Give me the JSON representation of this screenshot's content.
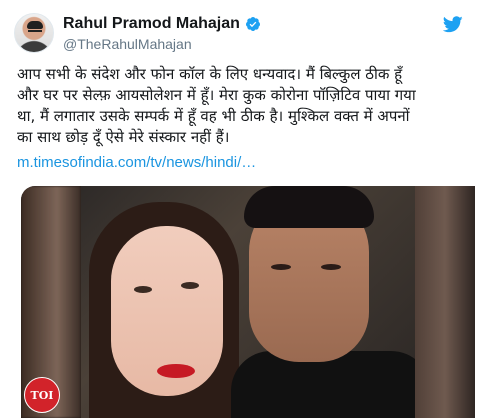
{
  "tweet": {
    "display_name": "Rahul Pramod Mahajan",
    "handle": "@TheRahulMahajan",
    "verified": true,
    "text_lines": [
      "आप सभी के संदेश और फोन कॉल के लिए धन्यवाद। मैं बिल्कुल ठीक हूँ",
      "और घर पर सेल्फ़ आयसोलेशन में हूँ। मेरा कुक कोरोना पॉज़िटिव पाया गया",
      "था, मैं लगातार उसके सम्पर्क में हूँ वह भी ठीक है। मुश्किल वक्त में अपनों",
      "का साथ छोड़ दूँ ऐसे मेरे संस्कार नहीं हैं।"
    ],
    "link_text": "m.timesofindia.com/tv/news/hindi/…",
    "media": {
      "badge_text": "TOI"
    }
  },
  "colors": {
    "link": "#1b95e0",
    "verified": "#1da1f2",
    "twitter_brand": "#1da1f2",
    "badge": "#d2232a"
  },
  "icons": {
    "verified": "verified-badge-icon",
    "brand": "twitter-bird-icon"
  }
}
